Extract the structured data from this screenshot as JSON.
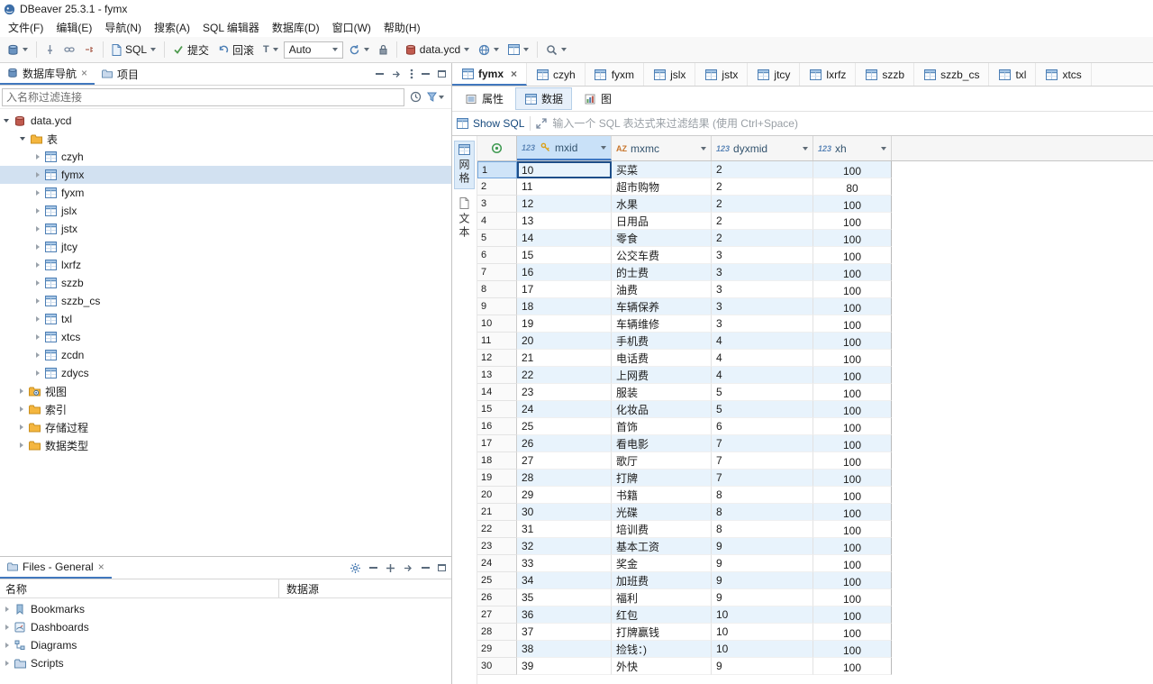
{
  "window": {
    "title": "DBeaver 25.3.1 - fymx"
  },
  "menubar": {
    "items": [
      "文件(F)",
      "编辑(E)",
      "导航(N)",
      "搜索(A)",
      "SQL 编辑器",
      "数据库(D)",
      "窗口(W)",
      "帮助(H)"
    ]
  },
  "toolbar": {
    "sql_label": "SQL",
    "commit_label": "提交",
    "rollback_label": "回滚",
    "tx_mode": "Auto",
    "connection": "data.ycd"
  },
  "navigator": {
    "tabs": [
      "数据库导航",
      "项目"
    ],
    "filter_placeholder": "入名称过滤连接",
    "database": "data.ycd",
    "tables_folder": "表",
    "tables": [
      "czyh",
      "fymx",
      "fyxm",
      "jslx",
      "jstx",
      "jtcy",
      "lxrfz",
      "szzb",
      "szzb_cs",
      "txl",
      "xtcs",
      "zcdn",
      "zdycs"
    ],
    "selected_table": "fymx",
    "other_nodes": [
      "视图",
      "索引",
      "存储过程",
      "数据类型"
    ]
  },
  "files_panel": {
    "tab": "Files - General",
    "columns": [
      "名称",
      "数据源"
    ],
    "items": [
      "Bookmarks",
      "Dashboards",
      "Diagrams",
      "Scripts"
    ]
  },
  "editor": {
    "tabs": [
      "fymx",
      "czyh",
      "fyxm",
      "jslx",
      "jstx",
      "jtcy",
      "lxrfz",
      "szzb",
      "szzb_cs",
      "txl",
      "xtcs"
    ],
    "active_tab": "fymx",
    "subtabs": [
      "属性",
      "数据",
      "图"
    ],
    "active_subtab": "数据"
  },
  "results": {
    "show_sql": "Show SQL",
    "filter_placeholder": "输入一个 SQL 表达式来过滤结果 (使用 Ctrl+Space)",
    "presentations": [
      "网格",
      "文本"
    ]
  },
  "grid": {
    "columns": [
      {
        "type": "123",
        "name": "mxid",
        "key": true
      },
      {
        "type": "AZ",
        "name": "mxmc",
        "key": false
      },
      {
        "type": "123",
        "name": "dyxmid",
        "key": false
      },
      {
        "type": "123",
        "name": "xh",
        "key": false
      }
    ],
    "rows": [
      [
        1,
        "10",
        "买菜",
        "2",
        "100"
      ],
      [
        2,
        "11",
        "超市购物",
        "2",
        "80"
      ],
      [
        3,
        "12",
        "水果",
        "2",
        "100"
      ],
      [
        4,
        "13",
        "日用品",
        "2",
        "100"
      ],
      [
        5,
        "14",
        "零食",
        "2",
        "100"
      ],
      [
        6,
        "15",
        "公交车费",
        "3",
        "100"
      ],
      [
        7,
        "16",
        "的士费",
        "3",
        "100"
      ],
      [
        8,
        "17",
        "油费",
        "3",
        "100"
      ],
      [
        9,
        "18",
        "车辆保养",
        "3",
        "100"
      ],
      [
        10,
        "19",
        "车辆维修",
        "3",
        "100"
      ],
      [
        11,
        "20",
        "手机费",
        "4",
        "100"
      ],
      [
        12,
        "21",
        "电话费",
        "4",
        "100"
      ],
      [
        13,
        "22",
        "上网费",
        "4",
        "100"
      ],
      [
        14,
        "23",
        "服装",
        "5",
        "100"
      ],
      [
        15,
        "24",
        "化妆品",
        "5",
        "100"
      ],
      [
        16,
        "25",
        "首饰",
        "6",
        "100"
      ],
      [
        17,
        "26",
        "看电影",
        "7",
        "100"
      ],
      [
        18,
        "27",
        "歌厅",
        "7",
        "100"
      ],
      [
        19,
        "28",
        "打牌",
        "7",
        "100"
      ],
      [
        20,
        "29",
        "书籍",
        "8",
        "100"
      ],
      [
        21,
        "30",
        "光碟",
        "8",
        "100"
      ],
      [
        22,
        "31",
        "培训费",
        "8",
        "100"
      ],
      [
        23,
        "32",
        "基本工资",
        "9",
        "100"
      ],
      [
        24,
        "33",
        "奖金",
        "9",
        "100"
      ],
      [
        25,
        "34",
        "加班费",
        "9",
        "100"
      ],
      [
        26,
        "35",
        "福利",
        "9",
        "100"
      ],
      [
        27,
        "36",
        "红包",
        "10",
        "100"
      ],
      [
        28,
        "37",
        "打牌赢钱",
        "10",
        "100"
      ],
      [
        29,
        "38",
        "捡钱：)",
        "10",
        "100"
      ],
      [
        30,
        "39",
        "外快",
        "9",
        "100"
      ]
    ]
  }
}
